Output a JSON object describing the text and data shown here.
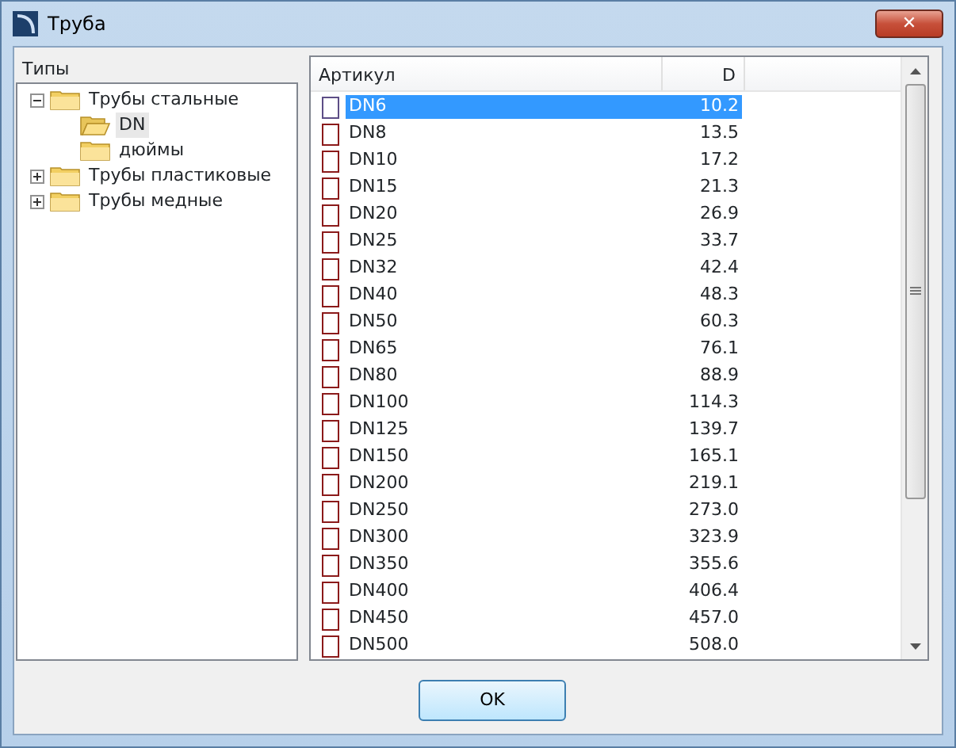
{
  "window": {
    "title": "Труба",
    "close": "✕"
  },
  "types_label": "Типы",
  "tree": [
    {
      "label": "Трубы стальные",
      "expanded": true,
      "selected": false,
      "children": [
        {
          "label": "DN",
          "selected": true
        },
        {
          "label": "дюймы",
          "selected": false
        }
      ]
    },
    {
      "label": "Трубы пластиковые",
      "expanded": false,
      "selected": false
    },
    {
      "label": "Трубы медные",
      "expanded": false,
      "selected": false
    }
  ],
  "table": {
    "columns": [
      "Артикул",
      "D"
    ],
    "rows": [
      {
        "article": "DN6",
        "d": "10.2",
        "selected": true,
        "checked": false
      },
      {
        "article": "DN8",
        "d": "13.5",
        "selected": false,
        "checked": false
      },
      {
        "article": "DN10",
        "d": "17.2",
        "selected": false,
        "checked": false
      },
      {
        "article": "DN15",
        "d": "21.3",
        "selected": false,
        "checked": false
      },
      {
        "article": "DN20",
        "d": "26.9",
        "selected": false,
        "checked": false
      },
      {
        "article": "DN25",
        "d": "33.7",
        "selected": false,
        "checked": false
      },
      {
        "article": "DN32",
        "d": "42.4",
        "selected": false,
        "checked": false
      },
      {
        "article": "DN40",
        "d": "48.3",
        "selected": false,
        "checked": false
      },
      {
        "article": "DN50",
        "d": "60.3",
        "selected": false,
        "checked": false
      },
      {
        "article": "DN65",
        "d": "76.1",
        "selected": false,
        "checked": false
      },
      {
        "article": "DN80",
        "d": "88.9",
        "selected": false,
        "checked": false
      },
      {
        "article": "DN100",
        "d": "114.3",
        "selected": false,
        "checked": false
      },
      {
        "article": "DN125",
        "d": "139.7",
        "selected": false,
        "checked": false
      },
      {
        "article": "DN150",
        "d": "165.1",
        "selected": false,
        "checked": false
      },
      {
        "article": "DN200",
        "d": "219.1",
        "selected": false,
        "checked": false
      },
      {
        "article": "DN250",
        "d": "273.0",
        "selected": false,
        "checked": false
      },
      {
        "article": "DN300",
        "d": "323.9",
        "selected": false,
        "checked": false
      },
      {
        "article": "DN350",
        "d": "355.6",
        "selected": false,
        "checked": false
      },
      {
        "article": "DN400",
        "d": "406.4",
        "selected": false,
        "checked": false
      },
      {
        "article": "DN450",
        "d": "457.0",
        "selected": false,
        "checked": false
      },
      {
        "article": "DN500",
        "d": "508.0",
        "selected": false,
        "checked": false
      }
    ]
  },
  "buttons": [
    "OK"
  ]
}
